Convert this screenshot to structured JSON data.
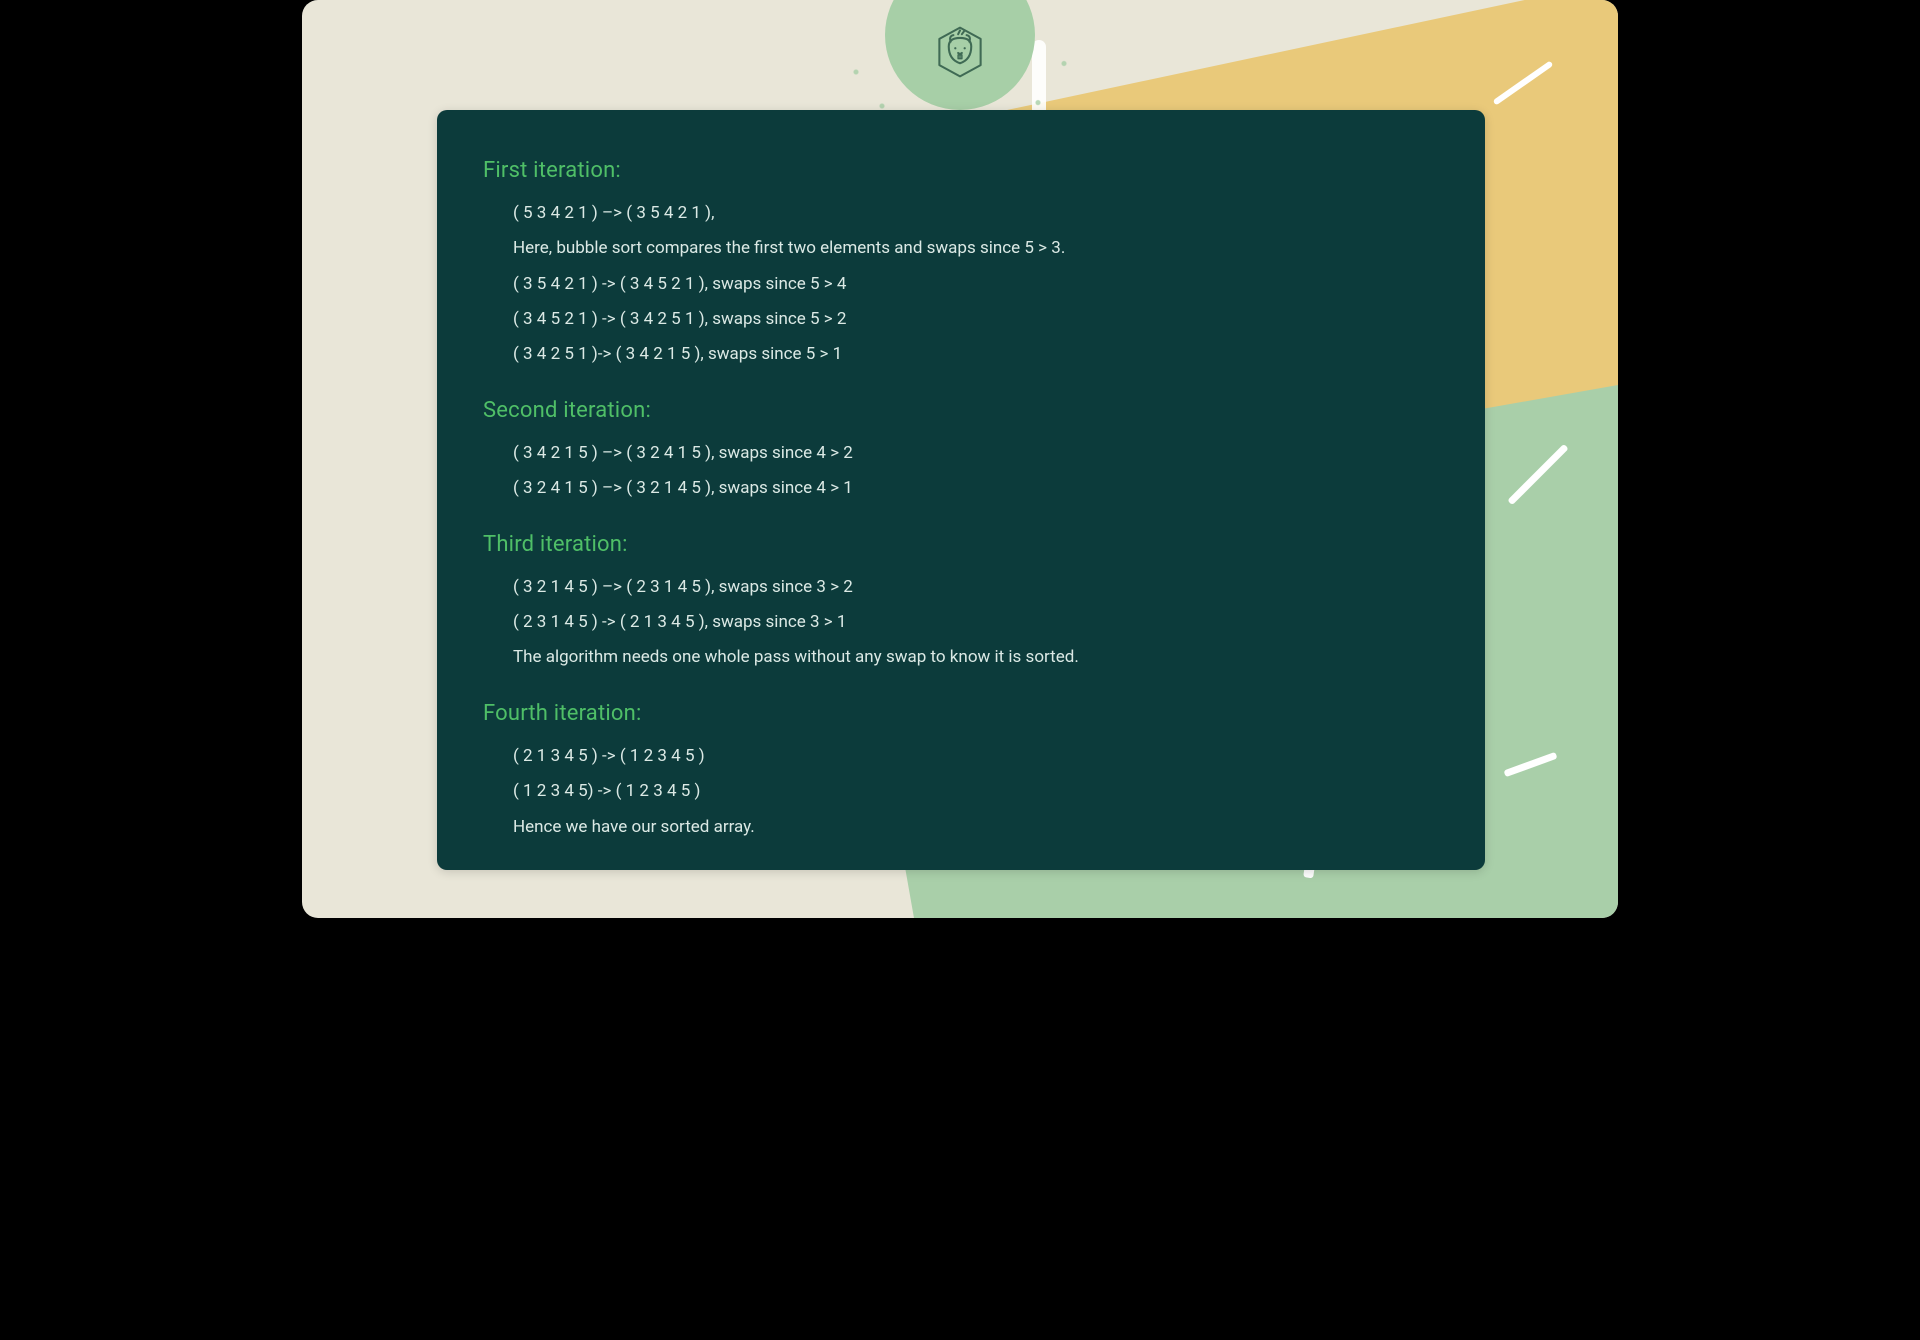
{
  "logo": {
    "name": "beaver-logo"
  },
  "sections": [
    {
      "heading": "First iteration:",
      "lines": [
        "( 5  3  4  2  1 ) –> ( 3  5  4  2  1 ),",
        "Here, bubble sort compares the first two elements and swaps since 5 > 3.",
        "( 3  5  4  2  1 ) ->  ( 3  4  5  2  1 ), swaps since 5 > 4",
        "( 3  4  5  2  1 )  ->  (  3  4  2  5  1  ), swaps since 5 > 2",
        "(  3  4  2  5  1 )-> (  3  4  2  1  5  ), swaps since 5 > 1"
      ]
    },
    {
      "heading": "Second iteration:",
      "lines": [
        "( 3 4 2 1 5 ) –> ( 3 2 4 1 5 ), swaps since 4 > 2",
        "( 3 2 4 1 5 ) –> ( 3 2 1 4 5 ), swaps since 4 > 1"
      ]
    },
    {
      "heading": "Third iteration:",
      "lines": [
        "( 3 2 1 4 5 ) –> ( 2 3 1 4 5 ), swaps since 3 > 2",
        "( 2 3 1 4 5 ) -> ( 2 1 3 4 5 ), swaps since 3 > 1",
        "The algorithm needs one whole pass without any swap to know it is sorted."
      ]
    },
    {
      "heading": "Fourth iteration:",
      "lines": [
        "( 2 1 3 4 5 ) -> ( 1 2 3 4 5 )",
        "( 1 2 3 4 5) -> ( 1 2 3 4 5 )",
        "Hence we have our sorted array."
      ]
    }
  ]
}
